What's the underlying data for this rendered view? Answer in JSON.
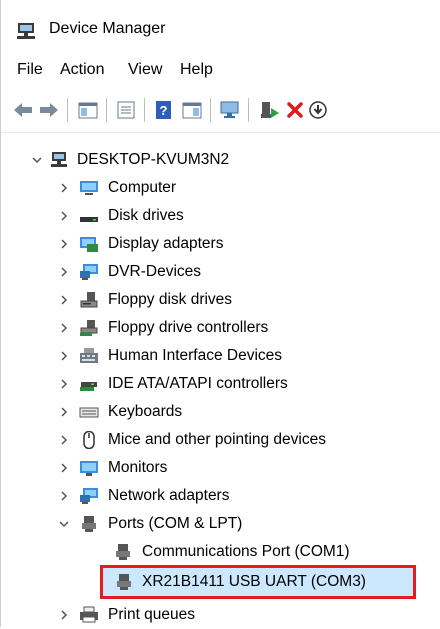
{
  "window": {
    "title": "Device Manager"
  },
  "menu": [
    "File",
    "Action",
    "View",
    "Help"
  ],
  "toolbar": {
    "icons": [
      "back-icon",
      "forward-icon",
      "show-hide-console-tree-icon",
      "properties-icon",
      "help-icon",
      "action-pane-icon",
      "scan-hardware-changes-icon",
      "enable-device-icon",
      "uninstall-device-icon",
      "update-driver-icon"
    ]
  },
  "tree": {
    "root": "DESKTOP-KVUM3N2",
    "categories": [
      "Computer",
      "Disk drives",
      "Display adapters",
      "DVR-Devices",
      "Floppy disk drives",
      "Floppy drive controllers",
      "Human Interface Devices",
      "IDE ATA/ATAPI controllers",
      "Keyboards",
      "Mice and other pointing devices",
      "Monitors",
      "Network adapters",
      "Ports (COM & LPT)"
    ],
    "ports_children": [
      "Communications Port (COM1)",
      "XR21B1411 USB UART (COM3)"
    ],
    "after_ports": [
      "Print queues"
    ],
    "selected_item": "XR21B1411 USB UART (COM3)",
    "highlight_color": "#e41b22",
    "selection_bg": "#cce8ff"
  }
}
